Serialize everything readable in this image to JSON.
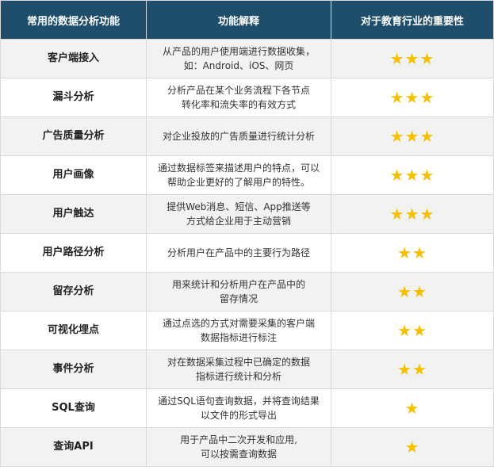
{
  "table": {
    "headers": [
      "常用的数据分析功能",
      "功能解释",
      "对于教育行业的重要性"
    ],
    "rows": [
      {
        "feature": "客户端接入",
        "desc_lines": [
          "从产品的用户使用端进行数据收集，",
          "如：Android、iOS、网页"
        ],
        "rating": 3
      },
      {
        "feature": "漏斗分析",
        "desc_lines": [
          "分析产品在某个业务流程下各节点",
          "转化率和流失率的有效方式"
        ],
        "rating": 3
      },
      {
        "feature": "广告质量分析",
        "desc_lines": [
          "对企业投放的广告质量进行统计分析"
        ],
        "rating": 3
      },
      {
        "feature": "用户画像",
        "desc_lines": [
          "通过数据标签来描述用户的特点，可以",
          "帮助企业更好的了解用户的特性。"
        ],
        "rating": 3
      },
      {
        "feature": "用户触达",
        "desc_lines": [
          "提供Web消息、短信、App推送等",
          "方式给企业用于主动营销"
        ],
        "rating": 3
      },
      {
        "feature": "用户路径分析",
        "desc_lines": [
          "分析用户在产品中的主要行为路径"
        ],
        "rating": 2
      },
      {
        "feature": "留存分析",
        "desc_lines": [
          "用来统计和分析用户在产品中的",
          "留存情况"
        ],
        "rating": 2
      },
      {
        "feature": "可视化埋点",
        "desc_lines": [
          "通过点选的方式对需要采集的客户端",
          "数据指标进行标注"
        ],
        "rating": 2
      },
      {
        "feature": "事件分析",
        "desc_lines": [
          "对在数据采集过程中已确定的数据",
          "指标进行统计和分析"
        ],
        "rating": 2
      },
      {
        "feature": "SQL查询",
        "desc_lines": [
          "通过SQL语句查询数据，并将查询结果",
          "以文件的形式导出"
        ],
        "rating": 1
      },
      {
        "feature": "查询API",
        "desc_lines": [
          "用于产品中二次开发和应用,",
          "可以按需查询数据"
        ],
        "rating": 1
      }
    ]
  },
  "colors": {
    "header_bg": "#1f4e6b",
    "header_text": "#ffffff",
    "row_alt": "#f2f2f2",
    "row_base": "#ffffff",
    "star": "#f5c000",
    "grid": "#d9d9d9"
  },
  "icons": {
    "star": "star-icon"
  }
}
